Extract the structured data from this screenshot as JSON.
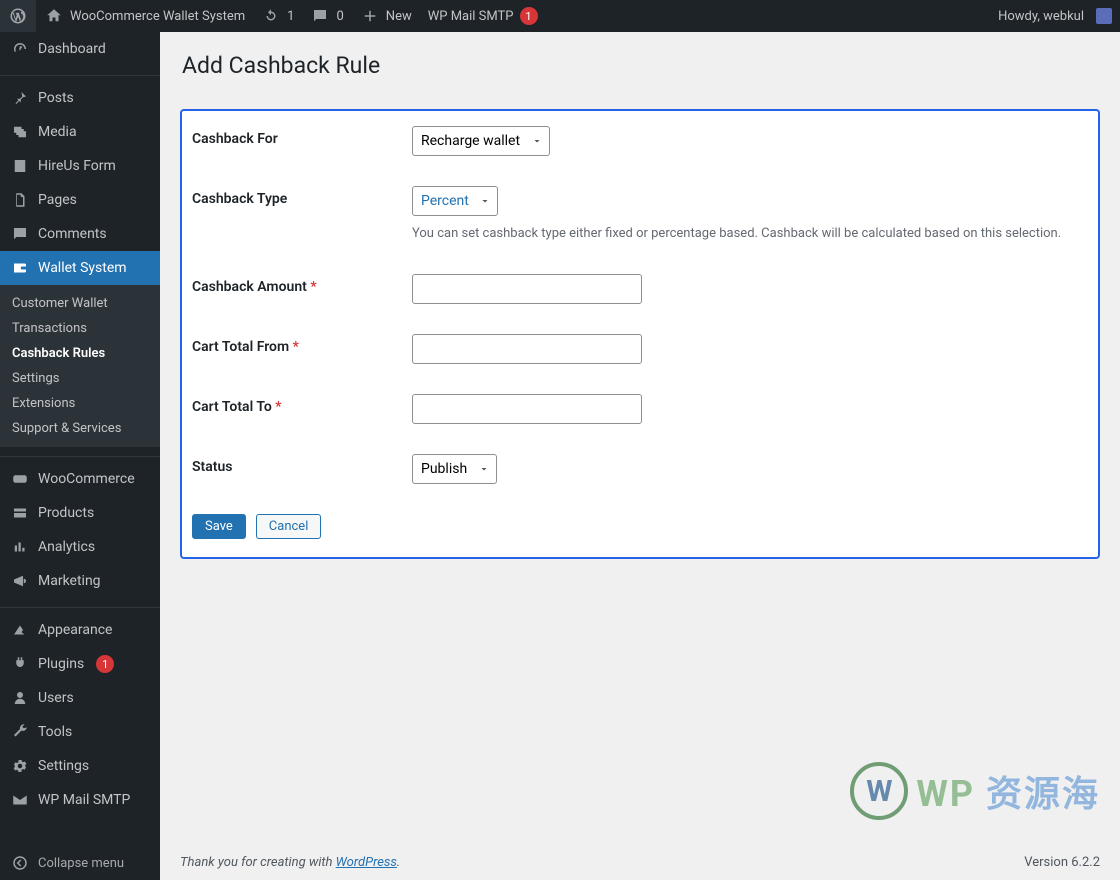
{
  "adminbar": {
    "site_name": "WooCommerce Wallet System",
    "updates": "1",
    "comments": "0",
    "new": "New",
    "wp_mail": "WP Mail SMTP",
    "wp_mail_badge": "1",
    "howdy": "Howdy, webkul"
  },
  "sidebar": {
    "dashboard": "Dashboard",
    "posts": "Posts",
    "media": "Media",
    "hireus": "HireUs Form",
    "pages": "Pages",
    "comments": "Comments",
    "wallet_system": "Wallet System",
    "submenu": {
      "customer_wallet": "Customer Wallet",
      "transactions": "Transactions",
      "cashback_rules": "Cashback Rules",
      "settings": "Settings",
      "extensions": "Extensions",
      "support": "Support & Services"
    },
    "woocommerce": "WooCommerce",
    "products": "Products",
    "analytics": "Analytics",
    "marketing": "Marketing",
    "appearance": "Appearance",
    "plugins": "Plugins",
    "plugins_badge": "1",
    "users": "Users",
    "tools": "Tools",
    "settings": "Settings",
    "wp_mail_smtp": "WP Mail SMTP",
    "collapse": "Collapse menu"
  },
  "page": {
    "title": "Add Cashback Rule",
    "fields": {
      "cashback_for_label": "Cashback For",
      "cashback_for_value": "Recharge wallet",
      "cashback_type_label": "Cashback Type",
      "cashback_type_value": "Percent",
      "cashback_type_desc": "You can set cashback type either fixed or percentage based. Cashback will be calculated based on this selection.",
      "cashback_amount_label": "Cashback Amount",
      "cart_total_from_label": "Cart Total From",
      "cart_total_to_label": "Cart Total To",
      "status_label": "Status",
      "status_value": "Publish"
    },
    "buttons": {
      "save": "Save",
      "cancel": "Cancel"
    }
  },
  "footer": {
    "thanks_prefix": "Thank you for creating with ",
    "wp_link": "WordPress",
    "version": "Version 6.2.2"
  },
  "watermark": {
    "text1": "WP",
    "text2": "资源海"
  }
}
